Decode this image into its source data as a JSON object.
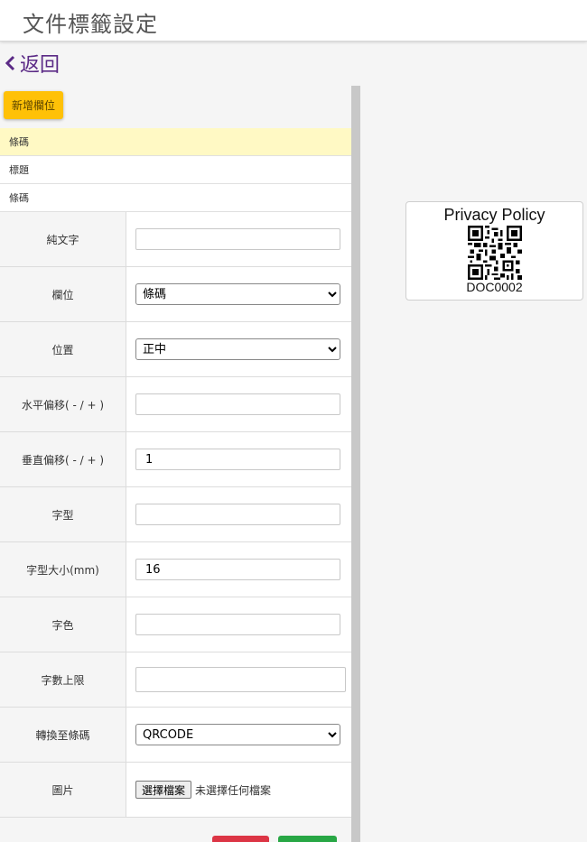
{
  "header": {
    "title": "文件標籤設定"
  },
  "nav": {
    "back_label": "返回"
  },
  "toolbar": {
    "add_field_label": "新增欄位"
  },
  "field_list": [
    {
      "label": "條碼",
      "active": true
    },
    {
      "label": "標題",
      "active": false
    },
    {
      "label": "條碼",
      "active": false
    }
  ],
  "properties": {
    "plain_text": {
      "label": "純文字",
      "value": ""
    },
    "field": {
      "label": "欄位",
      "selected": "條碼"
    },
    "position": {
      "label": "位置",
      "selected": "正中"
    },
    "h_offset": {
      "label": "水平偏移( - / + )",
      "value": ""
    },
    "v_offset": {
      "label": "垂直偏移( - / + )",
      "value": "1"
    },
    "font": {
      "label": "字型",
      "value": ""
    },
    "font_size": {
      "label": "字型大小(mm)",
      "value": "16"
    },
    "font_color": {
      "label": "字色",
      "value": ""
    },
    "max_chars": {
      "label": "字數上限",
      "value": ""
    },
    "convert_barcode": {
      "label": "轉換至條碼",
      "selected": "QRCODE"
    },
    "image": {
      "label": "圖片",
      "choose_label": "選擇檔案",
      "no_file_text": "未選擇任何檔案"
    }
  },
  "preview": {
    "title": "Privacy Policy",
    "code": "DOC0002"
  },
  "colors": {
    "accent": "#5b2a86",
    "warning": "#ffc107",
    "danger": "#dc3545",
    "success": "#28a745",
    "highlight": "#fff9c4"
  }
}
